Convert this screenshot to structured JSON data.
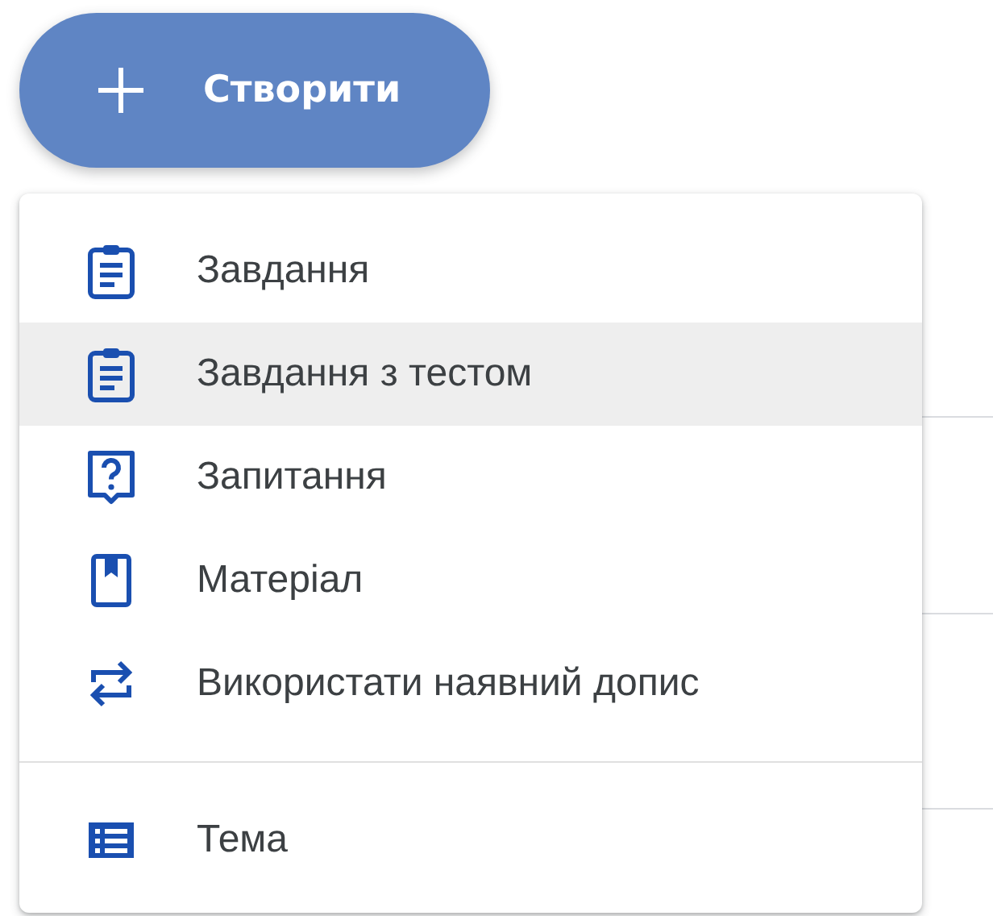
{
  "create_button": {
    "label": "Створити"
  },
  "menu": {
    "items": [
      {
        "kind": "assignment",
        "label": "Завдання",
        "selected": false
      },
      {
        "kind": "quiz",
        "label": "Завдання з тестом",
        "selected": true
      },
      {
        "kind": "question",
        "label": "Запитання",
        "selected": false
      },
      {
        "kind": "material",
        "label": "Матеріал",
        "selected": false
      },
      {
        "kind": "reuse",
        "label": "Використати наявний допис",
        "selected": false
      },
      {
        "kind": "divider"
      },
      {
        "kind": "topic",
        "label": "Тема",
        "selected": false
      }
    ]
  }
}
